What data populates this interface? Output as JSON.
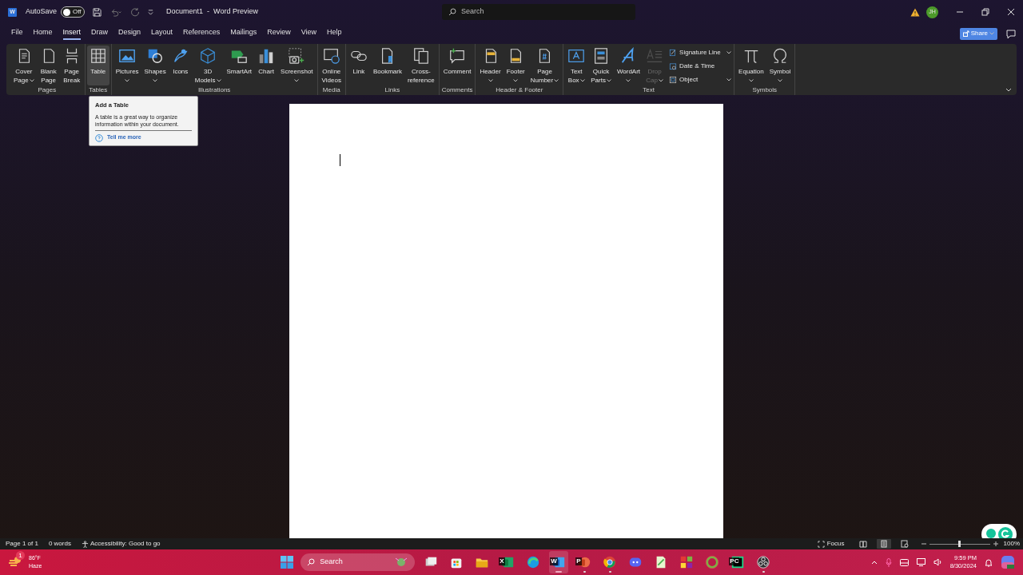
{
  "title_bar": {
    "app_letter": "W",
    "autosave_label": "AutoSave",
    "autosave": {
      "on": false,
      "label": "Off"
    },
    "document_title": "Document1  -  Word Preview",
    "search": {
      "placeholder": "Search"
    },
    "avatar": "JH"
  },
  "menu_tabs": [
    {
      "label": "File",
      "selected": false
    },
    {
      "label": "Home",
      "selected": false
    },
    {
      "label": "Insert",
      "selected": true
    },
    {
      "label": "Draw",
      "selected": false
    },
    {
      "label": "Design",
      "selected": false
    },
    {
      "label": "Layout",
      "selected": false
    },
    {
      "label": "References",
      "selected": false
    },
    {
      "label": "Mailings",
      "selected": false
    },
    {
      "label": "Review",
      "selected": false
    },
    {
      "label": "View",
      "selected": false
    },
    {
      "label": "Help",
      "selected": false
    }
  ],
  "share_button": "Share",
  "ribbon_groups": [
    {
      "label": "Pages",
      "buttons": [
        {
          "label": [
            "Cover",
            "Page"
          ],
          "dropdown": true,
          "hovered": false,
          "disabled": false
        },
        {
          "label": [
            "Blank",
            "Page"
          ],
          "dropdown": false,
          "hovered": false,
          "disabled": false
        },
        {
          "label": [
            "Page",
            "Break"
          ],
          "dropdown": false,
          "hovered": false,
          "disabled": false
        }
      ]
    },
    {
      "label": "Tables",
      "buttons": [
        {
          "label": [
            "Table"
          ],
          "dropdown": false,
          "hovered": true,
          "disabled": false
        }
      ]
    },
    {
      "label": "Illustrations",
      "buttons": [
        {
          "label": [
            "Pictures"
          ],
          "dropdown": true,
          "hovered": false,
          "disabled": false
        },
        {
          "label": [
            "Shapes"
          ],
          "dropdown": true,
          "hovered": false,
          "disabled": false
        },
        {
          "label": [
            "Icons"
          ],
          "dropdown": false,
          "hovered": false,
          "disabled": false
        },
        {
          "label": [
            "3D",
            "Models"
          ],
          "dropdown": true,
          "hovered": false,
          "disabled": false
        },
        {
          "label": [
            "SmartArt"
          ],
          "dropdown": false,
          "hovered": false,
          "disabled": false
        },
        {
          "label": [
            "Chart"
          ],
          "dropdown": false,
          "hovered": false,
          "disabled": false
        },
        {
          "label": [
            "Screenshot"
          ],
          "dropdown": true,
          "hovered": false,
          "disabled": false
        }
      ]
    },
    {
      "label": "Media",
      "buttons": [
        {
          "label": [
            "Online",
            "Videos"
          ],
          "dropdown": false,
          "hovered": false,
          "disabled": false
        }
      ]
    },
    {
      "label": "Links",
      "buttons": [
        {
          "label": [
            "Link"
          ],
          "dropdown": false,
          "hovered": false,
          "disabled": false
        },
        {
          "label": [
            "Bookmark"
          ],
          "dropdown": false,
          "hovered": false,
          "disabled": false
        },
        {
          "label": [
            "Cross-",
            "reference"
          ],
          "dropdown": false,
          "hovered": false,
          "disabled": false
        }
      ]
    },
    {
      "label": "Comments",
      "buttons": [
        {
          "label": [
            "Comment"
          ],
          "dropdown": false,
          "hovered": false,
          "disabled": false
        }
      ]
    },
    {
      "label": "Header & Footer",
      "buttons": [
        {
          "label": [
            "Header"
          ],
          "dropdown": true,
          "hovered": false,
          "disabled": false
        },
        {
          "label": [
            "Footer"
          ],
          "dropdown": true,
          "hovered": false,
          "disabled": false
        },
        {
          "label": [
            "Page",
            "Number"
          ],
          "dropdown": true,
          "hovered": false,
          "disabled": false
        }
      ]
    },
    {
      "label": "Text",
      "buttons": [
        {
          "label": [
            "Text",
            "Box"
          ],
          "dropdown": true,
          "hovered": false,
          "disabled": false
        },
        {
          "label": [
            "Quick",
            "Parts"
          ],
          "dropdown": true,
          "hovered": false,
          "disabled": false
        },
        {
          "label": [
            "WordArt"
          ],
          "dropdown": true,
          "hovered": false,
          "disabled": false
        },
        {
          "label": [
            "Drop",
            "Cap"
          ],
          "dropdown": true,
          "hovered": false,
          "disabled": true
        }
      ],
      "small_buttons": [
        {
          "label": "Signature Line",
          "dropdown": true
        },
        {
          "label": "Date & Time",
          "dropdown": false
        },
        {
          "label": "Object",
          "dropdown": true
        }
      ]
    },
    {
      "label": "Symbols",
      "buttons": [
        {
          "label": [
            "Equation"
          ],
          "dropdown": true,
          "hovered": false,
          "disabled": false
        },
        {
          "label": [
            "Symbol"
          ],
          "dropdown": true,
          "hovered": false,
          "disabled": false
        }
      ]
    }
  ],
  "tooltip": {
    "title": "Add a Table",
    "body": "A table is a great way to organize information within your document.",
    "link": "Tell me more"
  },
  "status_bar": {
    "page": "Page 1 of 1",
    "words": "0 words",
    "accessibility": "Accessibility: Good to go",
    "focus": "Focus",
    "views": [
      {
        "selected": false
      },
      {
        "selected": true
      },
      {
        "selected": false
      }
    ],
    "zoom": {
      "level": 0.5,
      "label": "100%"
    }
  },
  "taskbar": {
    "weather": {
      "badge": "1",
      "temperature": "86°F",
      "condition": "Haze"
    },
    "search": {
      "placeholder": "Search"
    },
    "apps": [
      {
        "selected": false,
        "running": false
      },
      {
        "selected": false,
        "running": false
      },
      {
        "selected": false,
        "running": false
      },
      {
        "letter": "X",
        "selected": false,
        "running": false
      },
      {
        "selected": false,
        "running": false
      },
      {
        "letter": "W",
        "selected": true,
        "running": true
      },
      {
        "letter": "P",
        "selected": false,
        "running": true
      },
      {
        "selected": false,
        "running": true
      },
      {
        "selected": false,
        "running": false
      },
      {
        "selected": false,
        "running": false
      },
      {
        "selected": false,
        "running": false
      },
      {
        "selected": false,
        "running": false
      },
      {
        "letter": "PC",
        "selected": false,
        "running": false
      },
      {
        "selected": false,
        "running": true
      }
    ],
    "time": "9:59 PM",
    "date": "8/30/2024"
  }
}
